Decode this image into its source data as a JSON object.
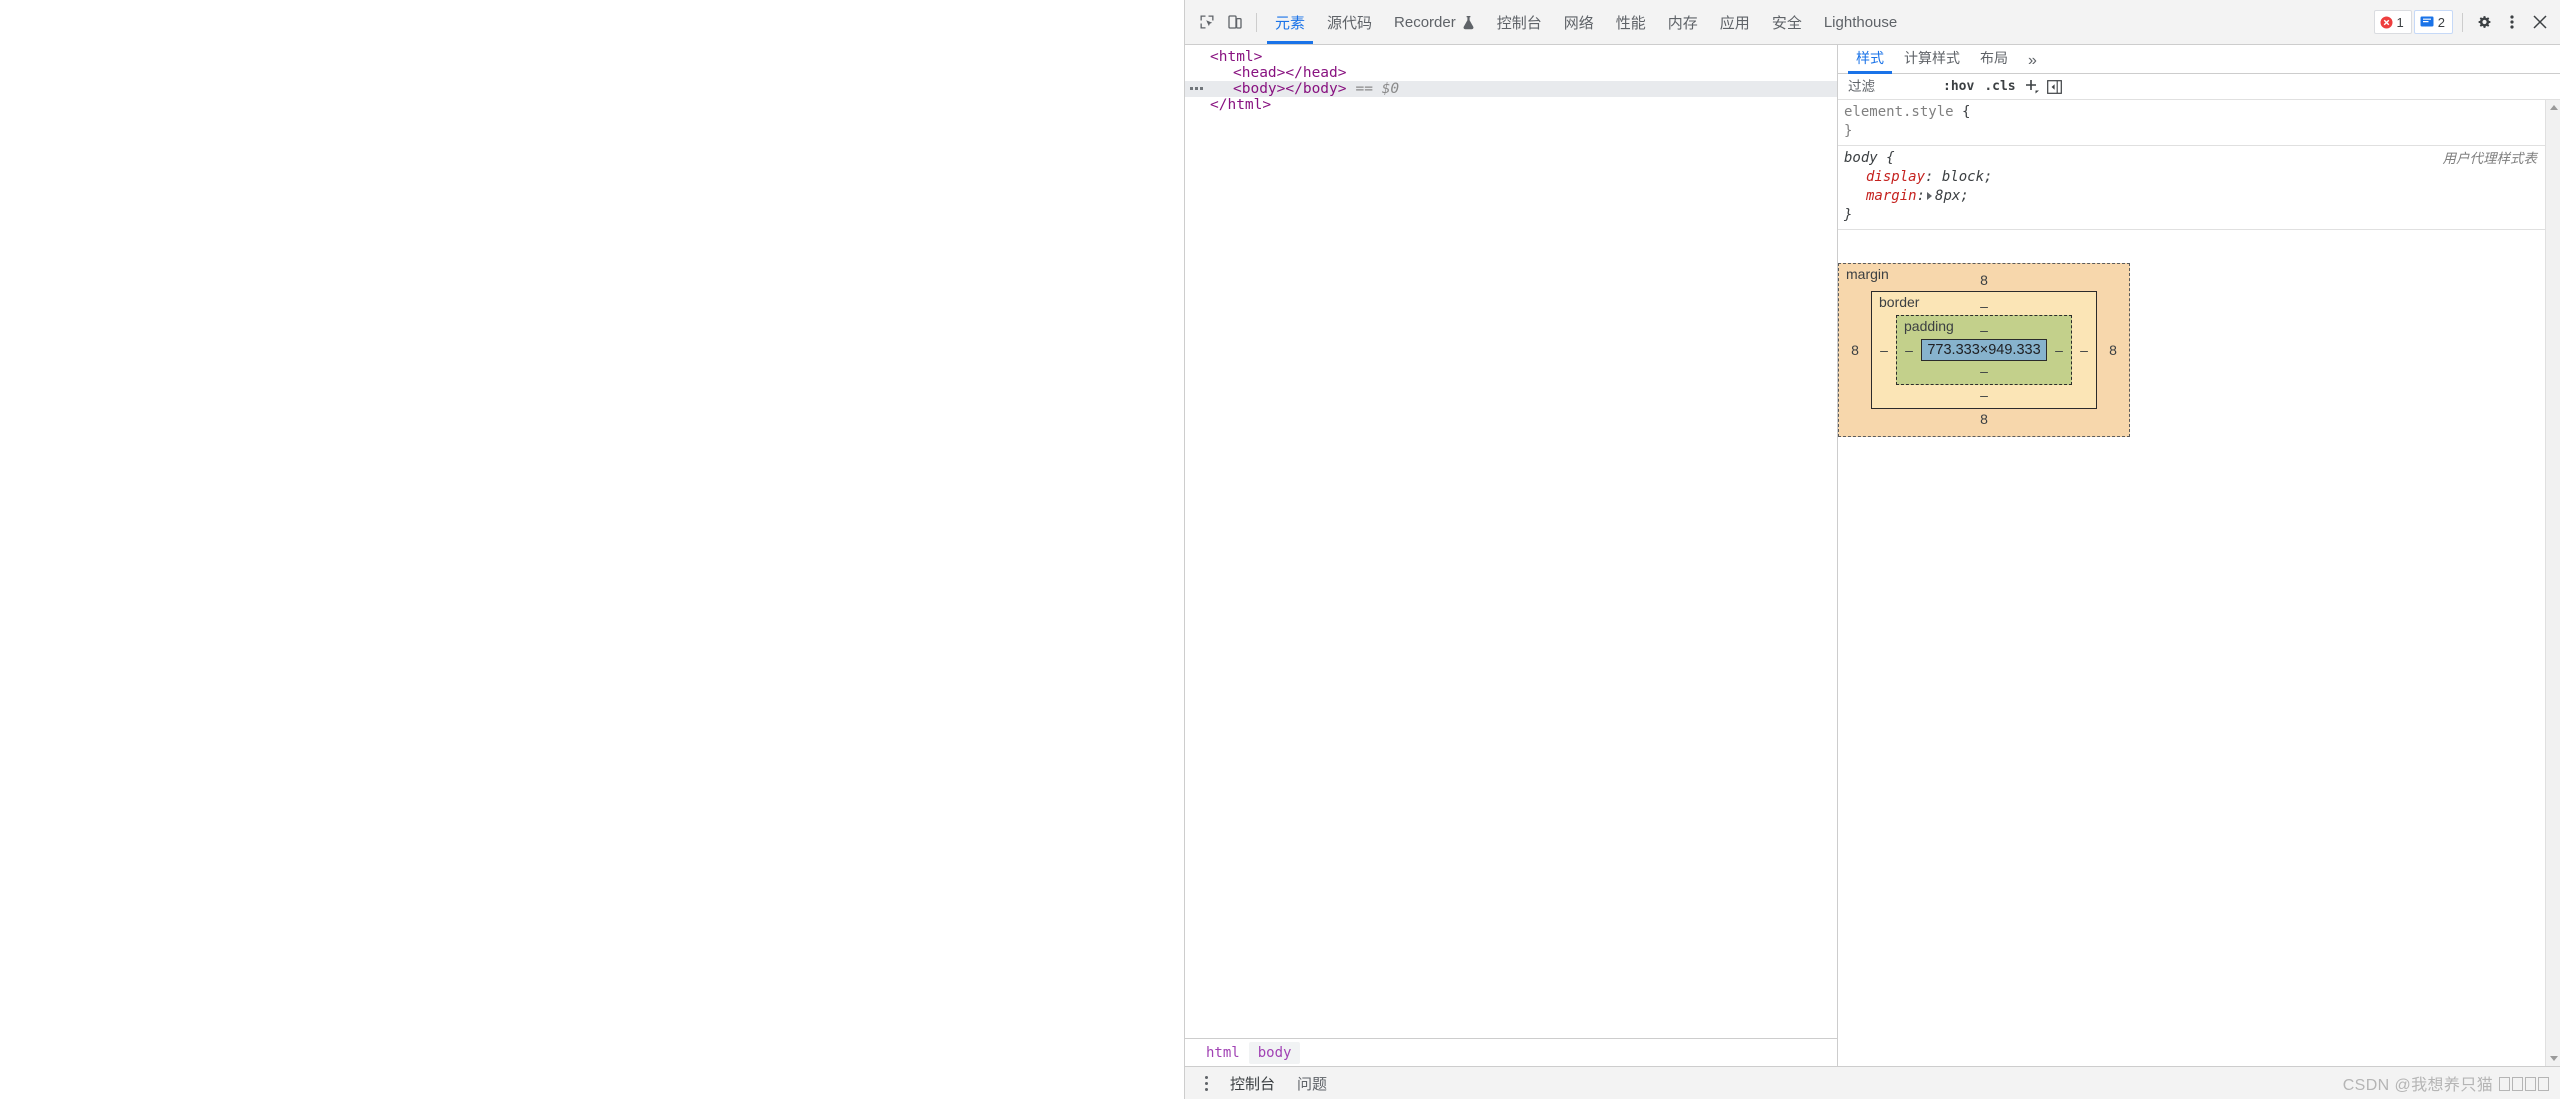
{
  "toolbar": {
    "inspect_icon": "inspect-element-icon",
    "device_icon": "device-toolbar-icon",
    "tabs": [
      {
        "label": "元素",
        "name": "tab-elements",
        "active": true,
        "flask": false
      },
      {
        "label": "源代码",
        "name": "tab-sources",
        "active": false,
        "flask": false
      },
      {
        "label": "Recorder",
        "name": "tab-recorder",
        "active": false,
        "flask": true
      },
      {
        "label": "控制台",
        "name": "tab-console",
        "active": false,
        "flask": false
      },
      {
        "label": "网络",
        "name": "tab-network",
        "active": false,
        "flask": false
      },
      {
        "label": "性能",
        "name": "tab-performance",
        "active": false,
        "flask": false
      },
      {
        "label": "内存",
        "name": "tab-memory",
        "active": false,
        "flask": false
      },
      {
        "label": "应用",
        "name": "tab-application",
        "active": false,
        "flask": false
      },
      {
        "label": "安全",
        "name": "tab-security",
        "active": false,
        "flask": false
      },
      {
        "label": "Lighthouse",
        "name": "tab-lighthouse",
        "active": false,
        "flask": false
      }
    ],
    "error_count": "1",
    "message_count": "2",
    "settings_icon": "gear-icon",
    "more_icon": "kebab-menu-icon",
    "close_icon": "close-icon",
    "error_color": "#ee3e3e",
    "message_color": "#1a73e8",
    "accent_color": "#1a73e8"
  },
  "dom": {
    "rows": [
      {
        "indent": 1,
        "text": "<html>",
        "selected": false,
        "dots": false,
        "suffix": ""
      },
      {
        "indent": 2,
        "text": "<head></head>",
        "selected": false,
        "dots": false,
        "suffix": ""
      },
      {
        "indent": 2,
        "text": "<body></body>",
        "selected": true,
        "dots": true,
        "suffix": "== $0"
      },
      {
        "indent": 1,
        "text": "</html>",
        "selected": false,
        "dots": false,
        "suffix": ""
      }
    ],
    "breadcrumbs": [
      {
        "label": "html",
        "active": false
      },
      {
        "label": "body",
        "active": true
      }
    ]
  },
  "styles": {
    "tabs": [
      {
        "label": "样式",
        "name": "tab-styles",
        "active": true
      },
      {
        "label": "计算样式",
        "name": "tab-computed",
        "active": false
      },
      {
        "label": "布局",
        "name": "tab-layout",
        "active": false
      },
      {
        "label": "»",
        "name": "tab-more",
        "active": false
      }
    ],
    "filter_placeholder": "过滤",
    "filter_value": "",
    "hov_label": ":hov",
    "cls_label": ".cls",
    "new_rule_icon": "plus-icon",
    "toggle_sidebar_icon": "toggle-element-state-icon",
    "rules": [
      {
        "selector": "element.style",
        "origin": "",
        "inline": true,
        "props": []
      },
      {
        "selector": "body",
        "origin": "用户代理样式表",
        "inline": false,
        "props": [
          {
            "name": "display",
            "value": "block",
            "expandable": false
          },
          {
            "name": "margin",
            "value": "8px",
            "expandable": true
          }
        ]
      }
    ],
    "box_model": {
      "margin_label": "margin",
      "margin_top": "8",
      "margin_right": "8",
      "margin_bottom": "8",
      "margin_left": "8",
      "border_label": "border",
      "border_top": "–",
      "border_right": "–",
      "border_bottom": "–",
      "border_left": "–",
      "padding_label": "padding",
      "padding_top": "–",
      "padding_right": "–",
      "padding_bottom": "–",
      "padding_left": "–",
      "content_size": "773.333×949.333",
      "colors": {
        "margin": "#f7d7ac",
        "border": "#fbe5b6",
        "padding": "#c3d08b",
        "content": "#87b3cd"
      }
    }
  },
  "drawer": {
    "more_icon": "kebab-menu-icon",
    "tabs": [
      {
        "label": "控制台",
        "name": "drawer-tab-console"
      },
      {
        "label": "问题",
        "name": "drawer-tab-issues"
      }
    ]
  },
  "watermark": {
    "text": "CSDN @我想养只猫"
  }
}
